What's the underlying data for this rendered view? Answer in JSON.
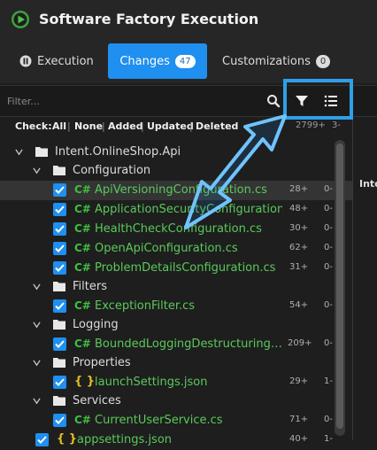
{
  "title": "Software Factory Execution",
  "tabs": [
    {
      "label": "Execution"
    },
    {
      "label": "Changes",
      "count": "47"
    },
    {
      "label": "Customizations",
      "count": "0"
    }
  ],
  "filter": {
    "placeholder": "Filter...",
    "right_header": "Inte"
  },
  "check": {
    "label": "Check:",
    "options": [
      "All",
      "None",
      "Added",
      "Updated",
      "Deleted"
    ],
    "num_a": "2799+",
    "num_b": "3-"
  },
  "tree": [
    {
      "label": "Intent.OnlineShop.Api",
      "type": "folder",
      "num_a": "",
      "num_b": ""
    },
    {
      "label": "Configuration",
      "type": "folder",
      "num_a": "",
      "num_b": ""
    },
    {
      "label": "ApiVersioningConfiguration.cs",
      "type": "cs",
      "num_a": "28+",
      "num_b": "0-"
    },
    {
      "label": "ApplicationSecurityConfiguration.cs",
      "type": "cs",
      "num_a": "48+",
      "num_b": "0-"
    },
    {
      "label": "HealthCheckConfiguration.cs",
      "type": "cs",
      "num_a": "30+",
      "num_b": "0-"
    },
    {
      "label": "OpenApiConfiguration.cs",
      "type": "cs",
      "num_a": "62+",
      "num_b": "0-"
    },
    {
      "label": "ProblemDetailsConfiguration.cs",
      "type": "cs",
      "num_a": "31+",
      "num_b": "0-"
    },
    {
      "label": "Filters",
      "type": "folder",
      "num_a": "",
      "num_b": ""
    },
    {
      "label": "ExceptionFilter.cs",
      "type": "cs",
      "num_a": "54+",
      "num_b": "0-"
    },
    {
      "label": "Logging",
      "type": "folder",
      "num_a": "",
      "num_b": ""
    },
    {
      "label": "BoundedLoggingDestructuringPolicy.cs",
      "type": "cs",
      "num_a": "209+",
      "num_b": "0-"
    },
    {
      "label": "Properties",
      "type": "folder",
      "num_a": "",
      "num_b": ""
    },
    {
      "label": "launchSettings.json",
      "type": "json",
      "num_a": "29+",
      "num_b": "1-"
    },
    {
      "label": "Services",
      "type": "folder",
      "num_a": "",
      "num_b": ""
    },
    {
      "label": "CurrentUserService.cs",
      "type": "cs",
      "num_a": "71+",
      "num_b": "0-"
    },
    {
      "label": "appsettings.json",
      "type": "json",
      "num_a": "40+",
      "num_b": "1-"
    }
  ],
  "colors": {
    "accent": "#1f8ff0",
    "highlight": "#2f9fe6",
    "file_green": "#5ac95a",
    "csharp_green": "#3fbf3f",
    "json_yellow": "#e0c020"
  },
  "icons": {
    "play": "play-circle-icon",
    "search": "search-icon",
    "filter": "filter-funnel-icon",
    "menu": "list-menu-icon"
  }
}
